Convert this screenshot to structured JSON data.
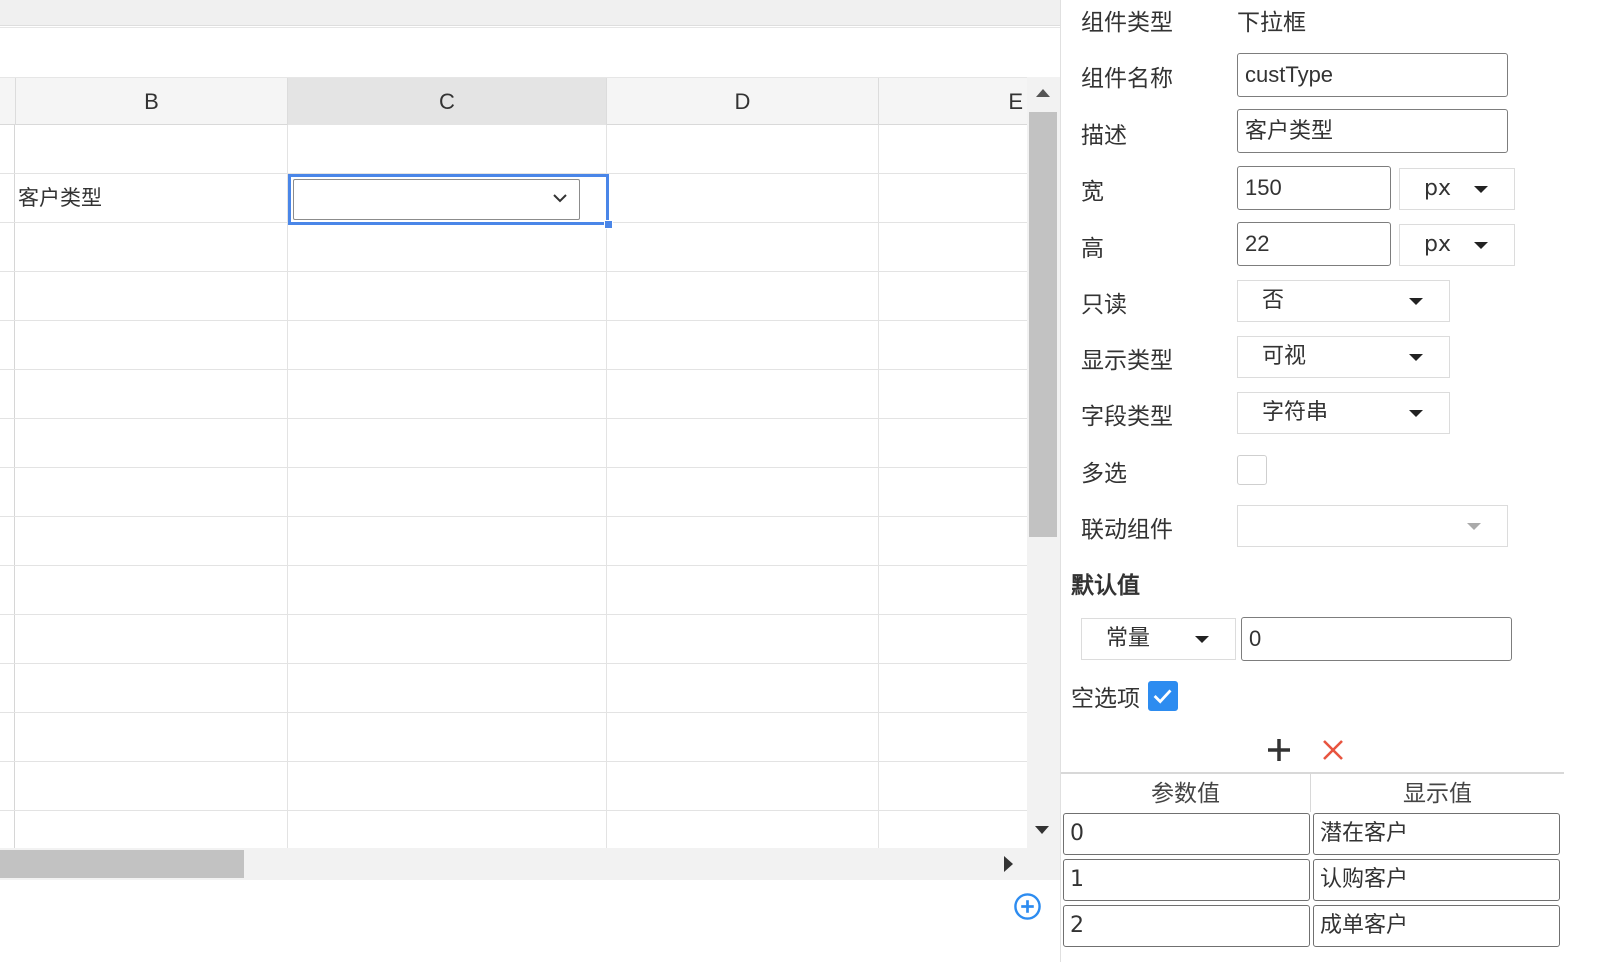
{
  "sheet": {
    "columns": [
      {
        "label": "B"
      },
      {
        "label": "C"
      },
      {
        "label": "D"
      },
      {
        "label": "E"
      }
    ],
    "cells": {
      "row2_b": "客户类型"
    }
  },
  "panel": {
    "component_type_label": "组件类型",
    "component_type_value": "下拉框",
    "component_name_label": "组件名称",
    "component_name_value": "custType",
    "description_label": "描述",
    "description_value": "客户类型",
    "width_label": "宽",
    "width_value": "150",
    "width_unit": "px",
    "height_label": "高",
    "height_value": "22",
    "height_unit": "px",
    "readonly_label": "只读",
    "readonly_value": "否",
    "display_type_label": "显示类型",
    "display_type_value": "可视",
    "field_type_label": "字段类型",
    "field_type_value": "字符串",
    "multi_select_label": "多选",
    "linked_component_label": "联动组件",
    "linked_component_value": "",
    "default_value_title": "默认值",
    "default_mode_value": "常量",
    "default_value": "0",
    "empty_option_label": "空选项",
    "options_table": {
      "headers": [
        "参数值",
        "显示值"
      ],
      "rows": [
        {
          "param": "0",
          "display": "潜在客户"
        },
        {
          "param": "1",
          "display": "认购客户"
        },
        {
          "param": "2",
          "display": "成单客户"
        }
      ]
    }
  },
  "icons": {
    "add_option": "plus-icon",
    "delete_option": "close-icon",
    "add_sheet": "plus-circle-icon",
    "select_chevron": "chevron-down-icon"
  },
  "colors": {
    "accent": "#2d8cf0",
    "selection": "#4a86e8",
    "delete": "#e8543f"
  }
}
